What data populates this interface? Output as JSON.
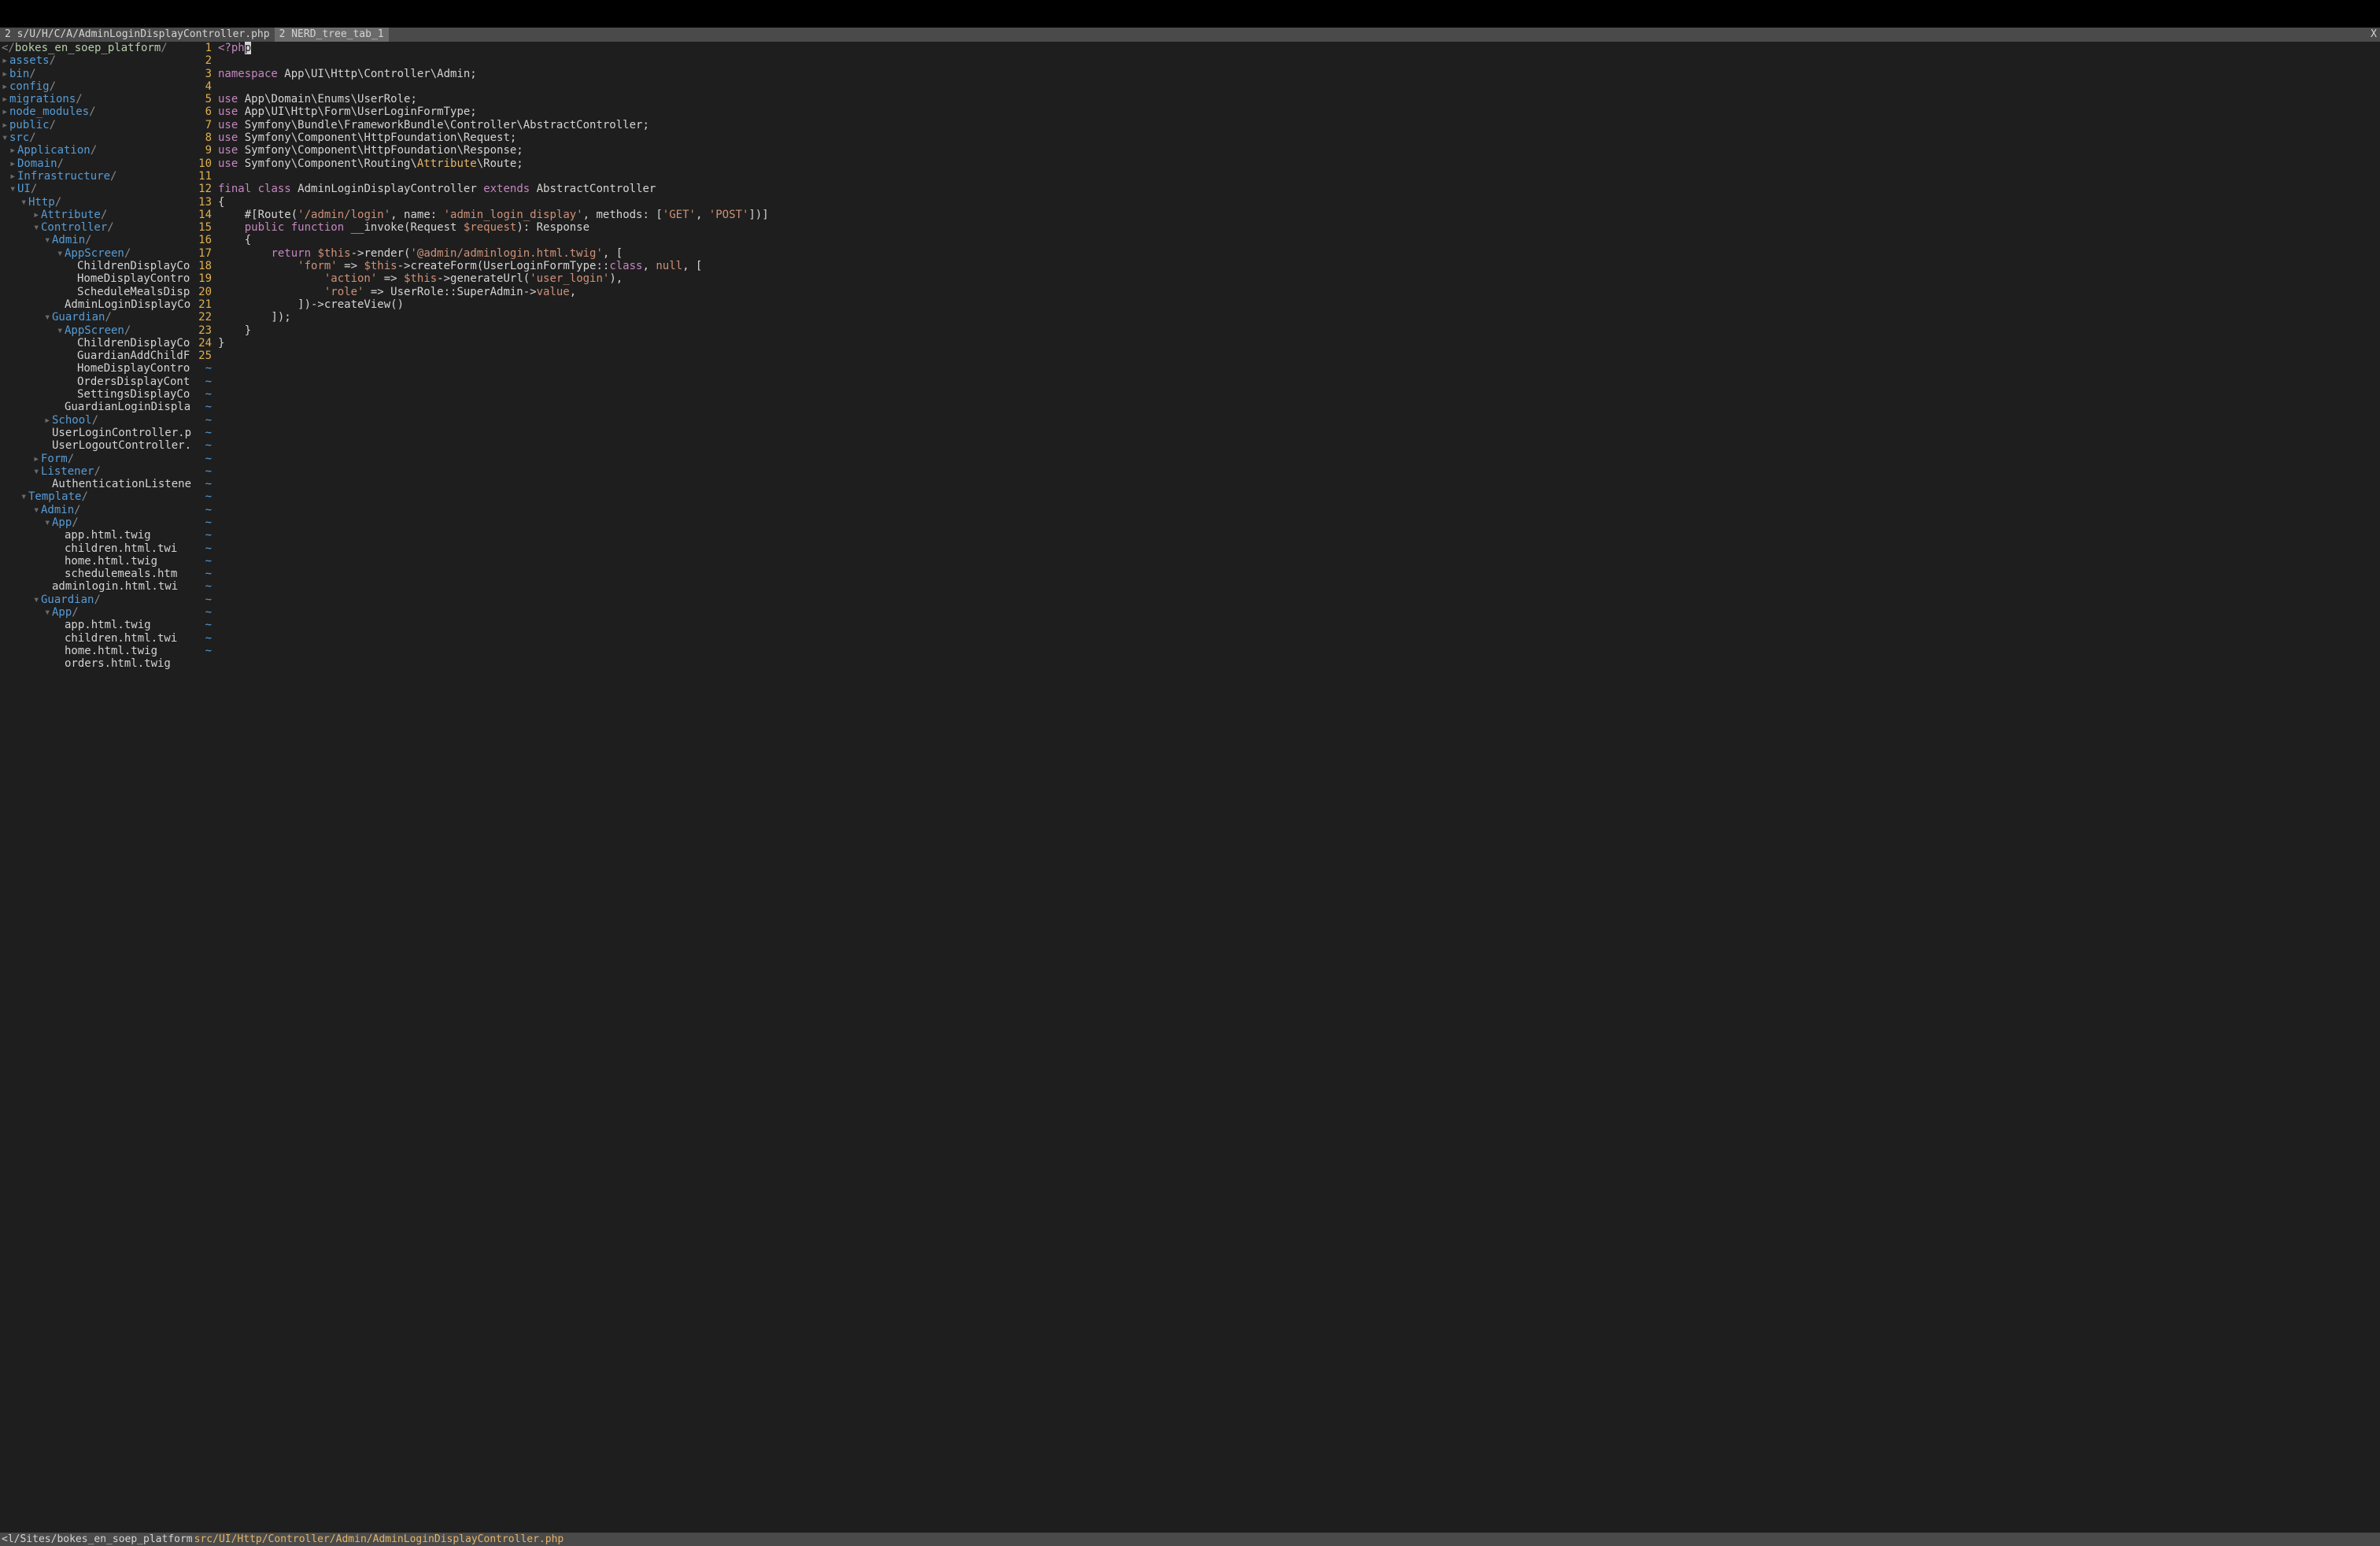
{
  "tabs": {
    "tab1_prefix": "2",
    "tab1_label": "s/U/H/C/A/AdminLoginDisplayController.php",
    "tab2_prefix": "2",
    "tab2_label": "NERD_tree_tab_1",
    "close": "X"
  },
  "tree": {
    "root_prefix": "</",
    "root_name": "bokes_en_soep_platform",
    "root_suffix": "/",
    "items": [
      {
        "indent": 0,
        "arrow": "▸",
        "label": "assets",
        "type": "dir"
      },
      {
        "indent": 0,
        "arrow": "▸",
        "label": "bin",
        "type": "dir"
      },
      {
        "indent": 0,
        "arrow": "▸",
        "label": "config",
        "type": "dir"
      },
      {
        "indent": 0,
        "arrow": "▸",
        "label": "migrations",
        "type": "dir"
      },
      {
        "indent": 0,
        "arrow": "▸",
        "label": "node_modules",
        "type": "dir"
      },
      {
        "indent": 0,
        "arrow": "▸",
        "label": "public",
        "type": "dir"
      },
      {
        "indent": 0,
        "arrow": "▾",
        "label": "src",
        "type": "dir"
      },
      {
        "indent": 1,
        "arrow": "▸",
        "label": "Application",
        "type": "dir"
      },
      {
        "indent": 1,
        "arrow": "▸",
        "label": "Domain",
        "type": "dir"
      },
      {
        "indent": 1,
        "arrow": "▸",
        "label": "Infrastructure",
        "type": "dir"
      },
      {
        "indent": 1,
        "arrow": "▾",
        "label": "UI",
        "type": "dir"
      },
      {
        "indent": 2,
        "arrow": "▾",
        "label": "Http",
        "type": "dir"
      },
      {
        "indent": 3,
        "arrow": "▸",
        "label": "Attribute",
        "type": "dir"
      },
      {
        "indent": 3,
        "arrow": "▾",
        "label": "Controller",
        "type": "dir"
      },
      {
        "indent": 4,
        "arrow": "▾",
        "label": "Admin",
        "type": "dir"
      },
      {
        "indent": 5,
        "arrow": "▾",
        "label": "AppScreen",
        "type": "dir"
      },
      {
        "indent": 6,
        "arrow": "",
        "label": "ChildrenDisplayCo",
        "type": "file"
      },
      {
        "indent": 6,
        "arrow": "",
        "label": "HomeDisplayContro",
        "type": "file"
      },
      {
        "indent": 6,
        "arrow": "",
        "label": "ScheduleMealsDisp",
        "type": "file"
      },
      {
        "indent": 5,
        "arrow": "",
        "label": "AdminLoginDisplayCo",
        "type": "file"
      },
      {
        "indent": 4,
        "arrow": "▾",
        "label": "Guardian",
        "type": "dir"
      },
      {
        "indent": 5,
        "arrow": "▾",
        "label": "AppScreen",
        "type": "dir"
      },
      {
        "indent": 6,
        "arrow": "",
        "label": "ChildrenDisplayCo",
        "type": "file"
      },
      {
        "indent": 6,
        "arrow": "",
        "label": "GuardianAddChildF",
        "type": "file"
      },
      {
        "indent": 6,
        "arrow": "",
        "label": "HomeDisplayContro",
        "type": "file"
      },
      {
        "indent": 6,
        "arrow": "",
        "label": "OrdersDisplayCont",
        "type": "file"
      },
      {
        "indent": 6,
        "arrow": "",
        "label": "SettingsDisplayCo",
        "type": "file"
      },
      {
        "indent": 5,
        "arrow": "",
        "label": "GuardianLoginDispla",
        "type": "file"
      },
      {
        "indent": 4,
        "arrow": "▸",
        "label": "School",
        "type": "dir"
      },
      {
        "indent": 4,
        "arrow": "",
        "label": "UserLoginController.p",
        "type": "file"
      },
      {
        "indent": 4,
        "arrow": "",
        "label": "UserLogoutController.",
        "type": "file"
      },
      {
        "indent": 3,
        "arrow": "▸",
        "label": "Form",
        "type": "dir"
      },
      {
        "indent": 3,
        "arrow": "▾",
        "label": "Listener",
        "type": "dir"
      },
      {
        "indent": 4,
        "arrow": "",
        "label": "AuthenticationListene",
        "type": "file"
      },
      {
        "indent": 2,
        "arrow": "▾",
        "label": "Template",
        "type": "dir"
      },
      {
        "indent": 3,
        "arrow": "▾",
        "label": "Admin",
        "type": "dir"
      },
      {
        "indent": 4,
        "arrow": "▾",
        "label": "App",
        "type": "dir"
      },
      {
        "indent": 5,
        "arrow": "",
        "label": "app.html.twig",
        "type": "file"
      },
      {
        "indent": 5,
        "arrow": "",
        "label": "children.html.twi",
        "type": "file"
      },
      {
        "indent": 5,
        "arrow": "",
        "label": "home.html.twig",
        "type": "file"
      },
      {
        "indent": 5,
        "arrow": "",
        "label": "schedulemeals.htm",
        "type": "file"
      },
      {
        "indent": 4,
        "arrow": "",
        "label": "adminlogin.html.twi",
        "type": "file"
      },
      {
        "indent": 3,
        "arrow": "▾",
        "label": "Guardian",
        "type": "dir"
      },
      {
        "indent": 4,
        "arrow": "▾",
        "label": "App",
        "type": "dir"
      },
      {
        "indent": 5,
        "arrow": "",
        "label": "app.html.twig",
        "type": "file"
      },
      {
        "indent": 5,
        "arrow": "",
        "label": "children.html.twi",
        "type": "file"
      },
      {
        "indent": 5,
        "arrow": "",
        "label": "home.html.twig",
        "type": "file"
      },
      {
        "indent": 5,
        "arrow": "",
        "label": "orders.html.twig",
        "type": "file"
      }
    ]
  },
  "code": {
    "lines": [
      {
        "n": "1",
        "html": "<span class='k-keyword'>&lt;?ph</span><span class='cursor'>p</span>"
      },
      {
        "n": "2",
        "html": ""
      },
      {
        "n": "3",
        "html": "<span class='k-keyword'>namespace</span> App\\UI\\Http\\Controller\\Admin;"
      },
      {
        "n": "4",
        "html": ""
      },
      {
        "n": "5",
        "html": "<span class='k-keyword'>use</span> App\\Domain\\Enums\\UserRole;"
      },
      {
        "n": "6",
        "html": "<span class='k-keyword'>use</span> App\\UI\\Http\\Form\\UserLoginFormType;"
      },
      {
        "n": "7",
        "html": "<span class='k-keyword'>use</span> Symfony\\Bundle\\FrameworkBundle\\Controller\\AbstractController;"
      },
      {
        "n": "8",
        "html": "<span class='k-keyword'>use</span> Symfony\\Component\\HttpFoundation\\Request;"
      },
      {
        "n": "9",
        "html": "<span class='k-keyword'>use</span> Symfony\\Component\\HttpFoundation\\Response;"
      },
      {
        "n": "10",
        "html": "<span class='k-keyword'>use</span> Symfony\\Component\\Routing\\<span class='k-route'>Attribute</span>\\Route;"
      },
      {
        "n": "11",
        "html": ""
      },
      {
        "n": "12",
        "html": "<span class='k-keyword'>final</span> <span class='k-keyword'>class</span> AdminLoginDisplayController <span class='k-keyword'>extends</span> AbstractController"
      },
      {
        "n": "13",
        "html": "{"
      },
      {
        "n": "14",
        "html": "    #[Route(<span class='k-string'>'/admin/login'</span>, name: <span class='k-string'>'admin_login_display'</span>, methods: [<span class='k-string'>'GET'</span>, <span class='k-string'>'POST'</span>])]"
      },
      {
        "n": "15",
        "html": "    <span class='k-keyword'>public</span> <span class='k-keyword'>function</span> __invoke(Request <span class='k-var'>$request</span>): Response"
      },
      {
        "n": "16",
        "html": "    {"
      },
      {
        "n": "17",
        "html": "        <span class='k-keyword'>return</span> <span class='k-this'>$this</span>-&gt;render(<span class='k-string'>'@admin/adminlogin.html.twig'</span>, ["
      },
      {
        "n": "18",
        "html": "            <span class='k-string'>'form'</span> =&gt; <span class='k-this'>$this</span>-&gt;createForm(UserLoginFormType::<span class='k-keyword'>class</span>, <span class='k-null'>null</span>, ["
      },
      {
        "n": "19",
        "html": "                <span class='k-string'>'action'</span> =&gt; <span class='k-this'>$this</span>-&gt;generateUrl(<span class='k-string'>'user_login'</span>),"
      },
      {
        "n": "20",
        "html": "                <span class='k-string'>'role'</span> =&gt; UserRole::SuperAdmin-&gt;<span class='k-value'>value</span>,"
      },
      {
        "n": "21",
        "html": "            ])-&gt;createView()"
      },
      {
        "n": "22",
        "html": "        ]);"
      },
      {
        "n": "23",
        "html": "    }"
      },
      {
        "n": "24",
        "html": "}"
      },
      {
        "n": "25",
        "html": ""
      }
    ],
    "tilde_count": 23,
    "tilde": "~"
  },
  "status": {
    "left": "<l/Sites/bokes_en_soep_platform",
    "path": "src/UI/Http/Controller/Admin/AdminLoginDisplayController.php"
  }
}
